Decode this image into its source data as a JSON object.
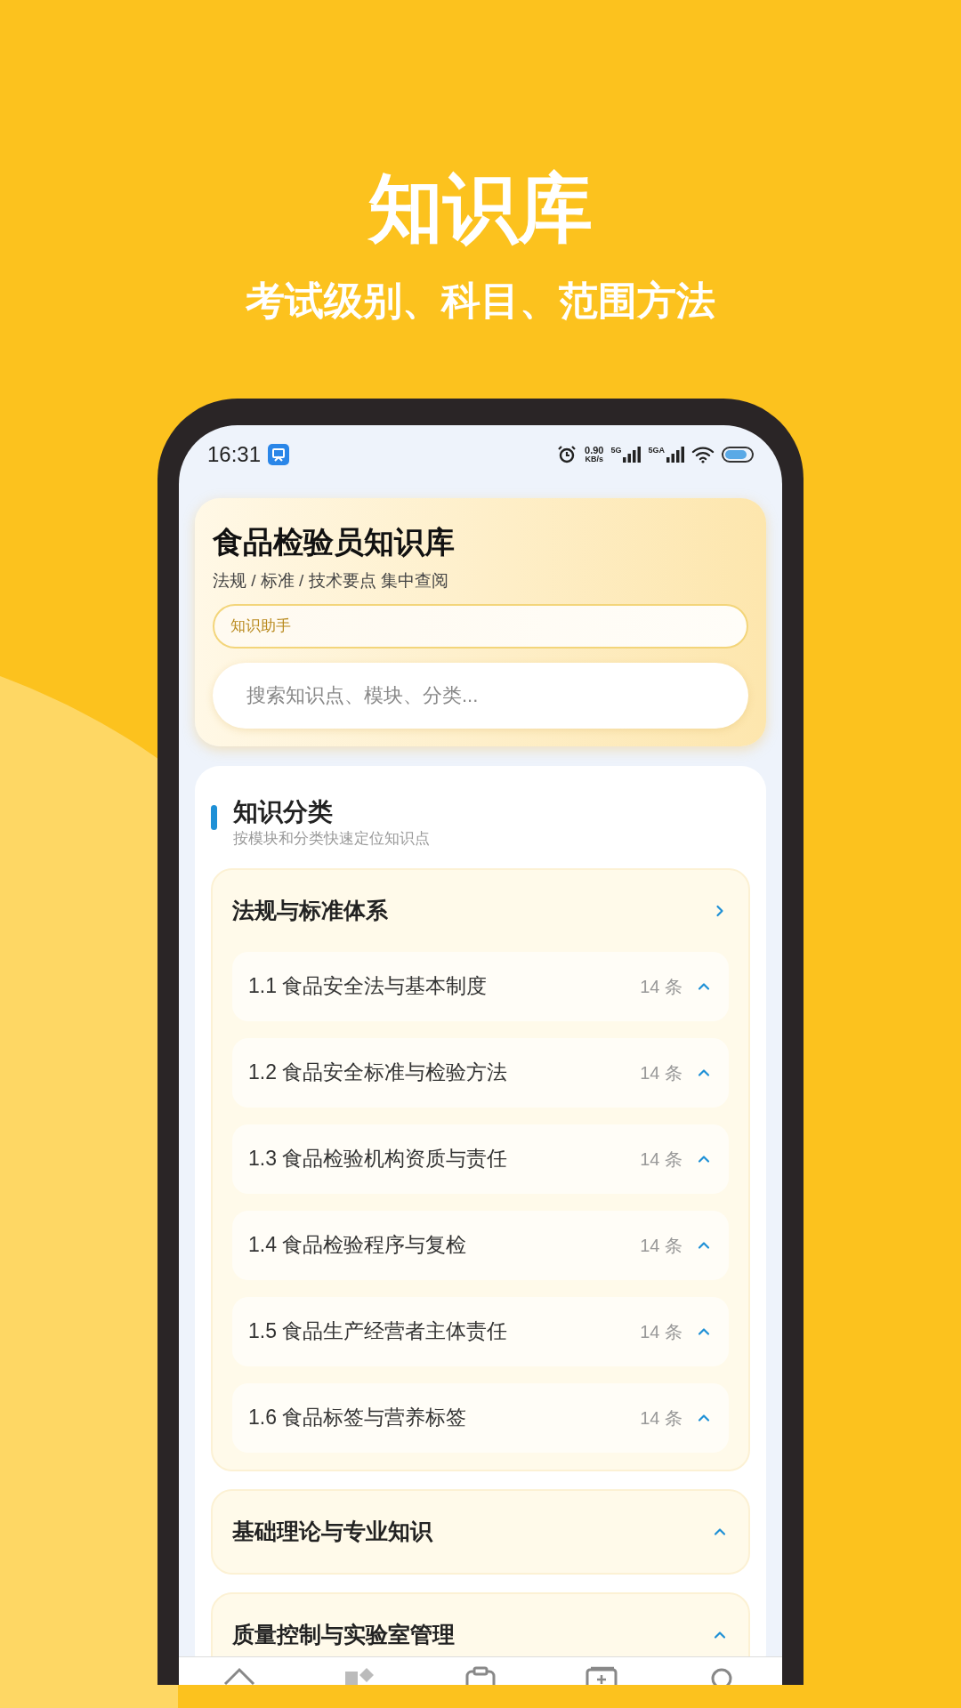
{
  "promo": {
    "title": "知识库",
    "subtitle": "考试级别、科目、范围方法"
  },
  "status_bar": {
    "time": "16:31",
    "net_speed": "0.90",
    "net_unit": "KB/s",
    "sim1": "5G",
    "sim2": "5GA"
  },
  "header": {
    "title": "食品检验员知识库",
    "subtitle": "法规 / 标准 / 技术要点 集中查阅",
    "assistant": "知识助手",
    "search": {
      "placeholder": "搜索知识点、模块、分类..."
    }
  },
  "section": {
    "title": "知识分类",
    "subtitle": "按模块和分类快速定位知识点"
  },
  "categories": [
    {
      "title": "法规与标准体系",
      "expanded": true,
      "children": [
        {
          "title": "1.1 食品安全法与基本制度",
          "count": "14 条"
        },
        {
          "title": "1.2 食品安全标准与检验方法",
          "count": "14 条"
        },
        {
          "title": "1.3 食品检验机构资质与责任",
          "count": "14 条"
        },
        {
          "title": "1.4 食品检验程序与复检",
          "count": "14 条"
        },
        {
          "title": "1.5 食品生产经营者主体责任",
          "count": "14 条"
        },
        {
          "title": "1.6 食品标签与营养标签",
          "count": "14 条"
        }
      ]
    },
    {
      "title": "基础理论与专业知识",
      "expanded": false
    },
    {
      "title": "质量控制与实验室管理",
      "expanded": false
    }
  ]
}
